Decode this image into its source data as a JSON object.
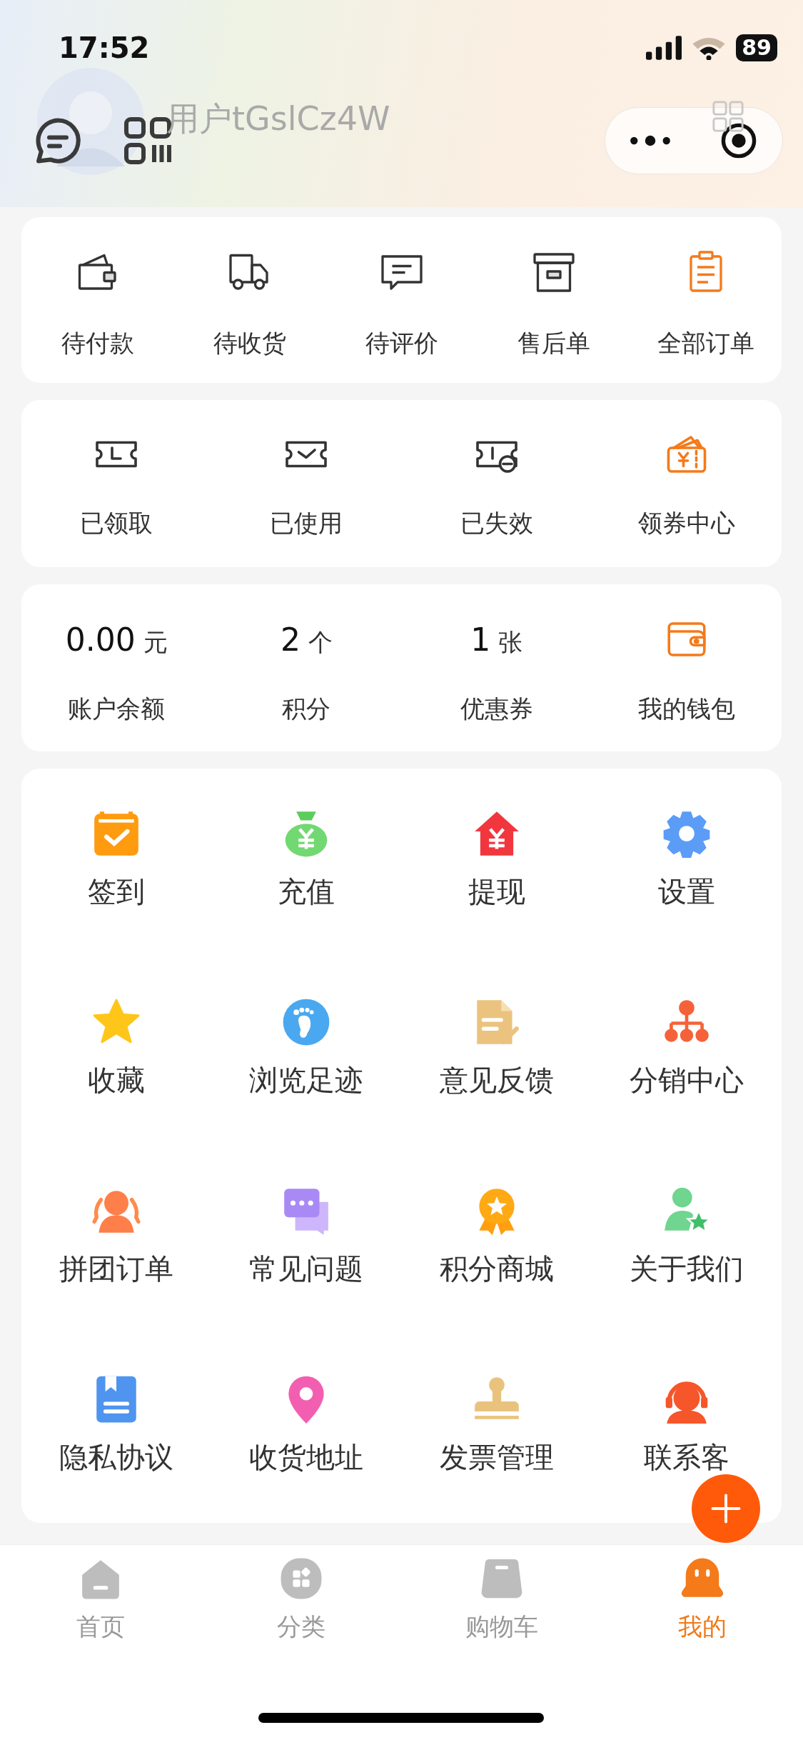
{
  "status_bar": {
    "time": "17:52",
    "battery": "89"
  },
  "header": {
    "username": "用户tGslCz4W"
  },
  "orders": [
    {
      "label": "待付款",
      "kind": "wallet"
    },
    {
      "label": "待收货",
      "kind": "truck"
    },
    {
      "label": "待评价",
      "kind": "chat"
    },
    {
      "label": "售后单",
      "kind": "archive"
    },
    {
      "label": "全部订单",
      "kind": "clipboard"
    }
  ],
  "coupons": [
    {
      "label": "已领取",
      "kind": "ticket-clock"
    },
    {
      "label": "已使用",
      "kind": "ticket-check"
    },
    {
      "label": "已失效",
      "kind": "ticket-minus"
    },
    {
      "label": "领券中心",
      "kind": "coupon-wallet"
    }
  ],
  "assets": [
    {
      "kind": "stat",
      "value": "0.00",
      "unit": "元",
      "label": "账户余额"
    },
    {
      "kind": "stat",
      "value": "2",
      "unit": "个",
      "label": "积分"
    },
    {
      "kind": "stat",
      "value": "1",
      "unit": "张",
      "label": "优惠券"
    },
    {
      "kind": "link",
      "label": "我的钱包"
    }
  ],
  "services": [
    {
      "label": "签到",
      "kind": "calendar"
    },
    {
      "label": "充值",
      "kind": "moneybag"
    },
    {
      "label": "提现",
      "kind": "houseyen"
    },
    {
      "label": "设置",
      "kind": "gear"
    },
    {
      "label": "收藏",
      "kind": "star"
    },
    {
      "label": "浏览足迹",
      "kind": "foot"
    },
    {
      "label": "意见反馈",
      "kind": "docpen"
    },
    {
      "label": "分销中心",
      "kind": "tree"
    },
    {
      "label": "拼团订单",
      "kind": "people"
    },
    {
      "label": "常见问题",
      "kind": "bubbles"
    },
    {
      "label": "积分商城",
      "kind": "medal"
    },
    {
      "label": "关于我们",
      "kind": "personstar"
    },
    {
      "label": "隐私协议",
      "kind": "book"
    },
    {
      "label": "收货地址",
      "kind": "pin"
    },
    {
      "label": "发票管理",
      "kind": "stamp"
    },
    {
      "label": "联系客",
      "kind": "headset"
    }
  ],
  "tabs": [
    {
      "label": "首页",
      "kind": "home",
      "selected": false
    },
    {
      "label": "分类",
      "kind": "category",
      "selected": false
    },
    {
      "label": "购物车",
      "kind": "cart",
      "selected": false
    },
    {
      "label": "我的",
      "kind": "me",
      "selected": true
    }
  ]
}
